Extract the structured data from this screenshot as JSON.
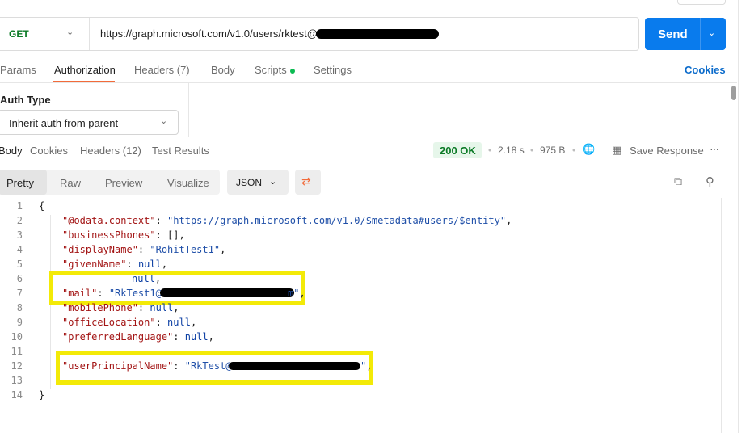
{
  "request": {
    "method": "GET",
    "url_visible": "https://graph.microsoft.com/v1.0/users/rktest@",
    "send_label": "Send"
  },
  "request_tabs": [
    {
      "label": "Params"
    },
    {
      "label": "Authorization",
      "active": true
    },
    {
      "label": "Headers (7)"
    },
    {
      "label": "Body"
    },
    {
      "label": "Scripts"
    },
    {
      "label": "Settings"
    }
  ],
  "cookies_label": "Cookies",
  "auth": {
    "title": "Auth Type",
    "selected": "Inherit auth from parent"
  },
  "response_tabs": [
    {
      "label": "Body",
      "active": true
    },
    {
      "label": "Cookies"
    },
    {
      "label": "Headers (12)"
    },
    {
      "label": "Test Results"
    }
  ],
  "response_meta": {
    "status": "200 OK",
    "time": "2.18 s",
    "size": "975 B",
    "save_label": "Save Response"
  },
  "view_tabs": [
    {
      "label": "Pretty",
      "active": true
    },
    {
      "label": "Raw"
    },
    {
      "label": "Preview"
    },
    {
      "label": "Visualize"
    }
  ],
  "format": "JSON",
  "code": {
    "line_numbers": [
      "1",
      "2",
      "3",
      "4",
      "5",
      "6",
      "7",
      "8",
      "9",
      "10",
      "11",
      "12",
      "13",
      "14"
    ],
    "open_brace": "{",
    "close_brace": "}",
    "odata_key": "\"@odata.context\"",
    "odata_value": "\"https://graph.microsoft.com/v1.0/$metadata#users/$entity\"",
    "business_key": "\"businessPhones\"",
    "business_value": "[]",
    "display_key": "\"displayName\"",
    "display_value": "\"RohitTest1\"",
    "given_key": "\"givenName\"",
    "null_value": "null",
    "mail_key": "\"mail\"",
    "mail_value_prefix": "\"RkTest1@",
    "mail_value_suffix": "m\"",
    "mobile_key": "\"mobilePhone\"",
    "office_key": "\"officeLocation\"",
    "language_key": "\"preferredLanguage\"",
    "upn_key": "\"userPrincipalName\"",
    "upn_value_prefix": "\"RkTest@",
    "upn_value_suffix": "\""
  },
  "colors": {
    "accent": "#097bed",
    "tab_underline": "#f26b3a",
    "status_green": "#0b7a26",
    "highlight": "#f3ea07"
  }
}
